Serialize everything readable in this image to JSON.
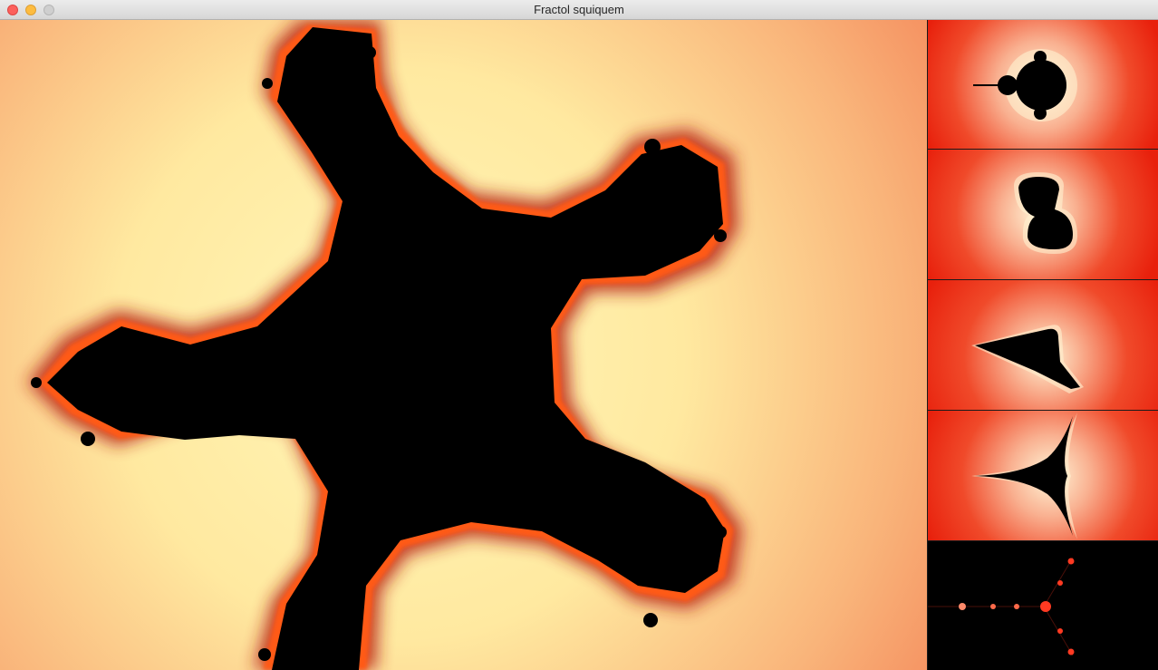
{
  "window": {
    "title": "Fractol squiquem",
    "buttons": [
      "close",
      "minimize",
      "zoom"
    ]
  },
  "main_view": {
    "fractal": "multibrot-order-6",
    "colors": {
      "set": "#000000",
      "far": "#f7a068",
      "glow": "#fff3b0",
      "edge": "#8b1a12",
      "band": "#ff6a14"
    }
  },
  "thumbnails": [
    {
      "fractal": "mandelbrot",
      "background": "#ee2a12"
    },
    {
      "fractal": "julia",
      "background": "#ee2a12"
    },
    {
      "fractal": "burning-ship",
      "background": "#ee2a12"
    },
    {
      "fractal": "tricorn",
      "background": "#ee2a12"
    },
    {
      "fractal": "multibrot-dark",
      "background": "#000000"
    }
  ]
}
